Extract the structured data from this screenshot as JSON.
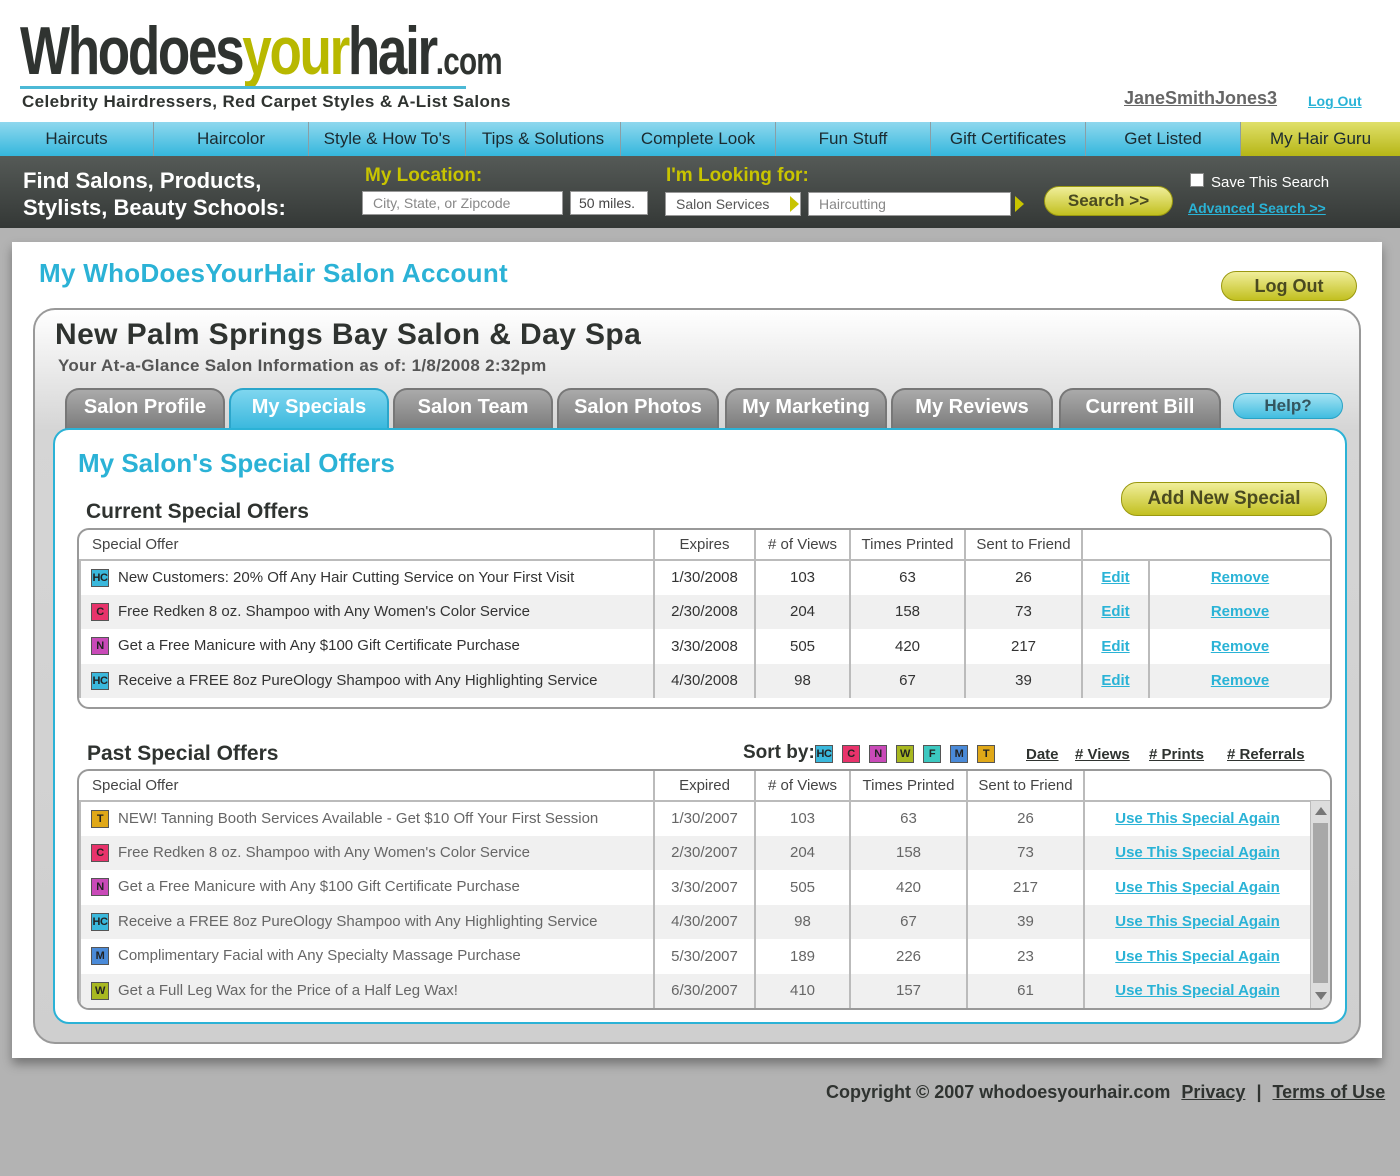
{
  "header": {
    "logo": {
      "w1": "Who",
      "w2": "does",
      "w3": "your",
      "w4": "hair",
      "dotcom": ".com"
    },
    "tagline": "Celebrity Hairdressers, Red Carpet Styles & A-List Salons",
    "username": "JaneSmithJones3",
    "logout": "Log Out"
  },
  "nav": {
    "items": [
      "Haircuts",
      "Haircolor",
      "Style & How To's",
      "Tips & Solutions",
      "Complete Look",
      "Fun Stuff",
      "Gift Certificates",
      "Get Listed",
      "My Hair Guru"
    ]
  },
  "search": {
    "title_line1": "Find Salons, Products,",
    "title_line2": "Stylists, Beauty Schools:",
    "location_label": "My Location:",
    "location_placeholder": "City, State, or Zipcode",
    "distance": "50 miles.",
    "looking_label": "I'm Looking for:",
    "category": "Salon Services",
    "service": "Haircutting",
    "button": "Search >>",
    "save_label": "Save This Search",
    "advanced": "Advanced Search >>"
  },
  "account": {
    "title": "My WhoDoesYourHair Salon Account",
    "logout": "Log Out",
    "salon_name": "New Palm Springs Bay Salon & Day Spa",
    "subtitle": "Your At-a-Glance Salon Information as of: 1/8/2008 2:32pm",
    "tabs": [
      "Salon Profile",
      "My Specials",
      "Salon Team",
      "Salon Photos",
      "My Marketing",
      "My Reviews",
      "Current Bill"
    ],
    "help": "Help?"
  },
  "offers": {
    "title": "My Salon's Special Offers",
    "current_title": "Current Special Offers",
    "add_button": "Add New Special",
    "current_headers": [
      "Special Offer",
      "Expires",
      "# of Views",
      "Times Printed",
      "Sent to Friend"
    ],
    "edit_label": "Edit",
    "remove_label": "Remove",
    "current_rows": [
      {
        "cat": "HC",
        "offer": "New Customers: 20% Off Any Hair Cutting Service on Your First Visit",
        "date": "1/30/2008",
        "views": "103",
        "printed": "63",
        "sent": "26"
      },
      {
        "cat": "C",
        "offer": "Free Redken 8 oz. Shampoo with Any Women's Color Service",
        "date": "2/30/2008",
        "views": "204",
        "printed": "158",
        "sent": "73"
      },
      {
        "cat": "N",
        "offer": "Get a Free Manicure with Any $100 Gift Certificate Purchase",
        "date": "3/30/2008",
        "views": "505",
        "printed": "420",
        "sent": "217"
      },
      {
        "cat": "HC",
        "offer": "Receive a FREE 8oz PureOlogy Shampoo with Any Highlighting Service",
        "date": "4/30/2008",
        "views": "98",
        "printed": "67",
        "sent": "39"
      }
    ],
    "past_title": "Past Special Offers",
    "sort_label": "Sort by:",
    "sort_chips": [
      "HC",
      "C",
      "N",
      "W",
      "F",
      "M",
      "T"
    ],
    "sort_links": [
      "Date",
      "# Views",
      "# Prints",
      "# Referrals"
    ],
    "past_headers": [
      "Special Offer",
      "Expired",
      "# of Views",
      "Times Printed",
      "Sent to Friend"
    ],
    "use_again": "Use This Special Again",
    "past_rows": [
      {
        "cat": "T",
        "offer": "NEW! Tanning Booth Services Available - Get $10 Off Your First Session",
        "date": "1/30/2007",
        "views": "103",
        "printed": "63",
        "sent": "26"
      },
      {
        "cat": "C",
        "offer": "Free Redken 8 oz. Shampoo with Any Women's Color Service",
        "date": "2/30/2007",
        "views": "204",
        "printed": "158",
        "sent": "73"
      },
      {
        "cat": "N",
        "offer": "Get a Free Manicure with Any $100 Gift Certificate Purchase",
        "date": "3/30/2007",
        "views": "505",
        "printed": "420",
        "sent": "217"
      },
      {
        "cat": "HC",
        "offer": "Receive a FREE 8oz PureOlogy Shampoo with Any Highlighting Service",
        "date": "4/30/2007",
        "views": "98",
        "printed": "67",
        "sent": "39"
      },
      {
        "cat": "M",
        "offer": "Complimentary Facial with Any Specialty Massage Purchase",
        "date": "5/30/2007",
        "views": "189",
        "printed": "226",
        "sent": "23"
      },
      {
        "cat": "W",
        "offer": "Get a Full Leg Wax for the Price of a Half Leg Wax!",
        "date": "6/30/2007",
        "views": "410",
        "printed": "157",
        "sent": "61"
      }
    ],
    "category_colors": {
      "HC": "#3ab8dc",
      "C": "#e8336b",
      "N": "#c94ab8",
      "W": "#a8b820",
      "F": "#3cc8c0",
      "M": "#4a8ad8",
      "T": "#e0a818"
    }
  },
  "footer": {
    "copyright": "Copyright © 2007  whodoesyourhair.com",
    "privacy": "Privacy",
    "separator": "|",
    "terms": "Terms of Use"
  }
}
